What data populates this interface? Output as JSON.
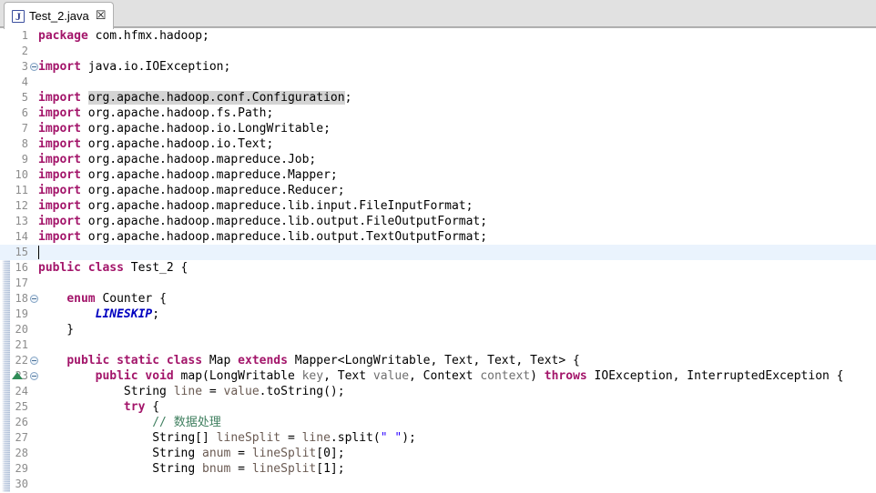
{
  "window": {
    "app": "eclipse-java-editor"
  },
  "tabbar": {
    "tabs": [
      {
        "label": "Test_2.java",
        "icon": "java-file-icon",
        "icon_glyph": "J",
        "close_glyph": "☒",
        "active": true
      }
    ]
  },
  "editor": {
    "current_line": 15,
    "total_visible_lines": 30,
    "colors": {
      "keyword": "#a3156a",
      "string": "#2a00ff",
      "comment": "#3f7f5f",
      "static_field": "#0000c0",
      "parameter": "#6f6f6f",
      "local_variable": "#6a5a52",
      "line_number": "#8c8c8c",
      "current_line_bg": "#eaf3fd",
      "occurrence_highlight_bg": "#d4d4d4",
      "fold_range_bar": "#aebfd8",
      "override_marker": "#2f8b57"
    },
    "lines": [
      {
        "n": 1,
        "fold": false,
        "tokens": [
          {
            "t": "package",
            "c": "kw"
          },
          {
            "t": " com.hfmx.hadoop;",
            "c": "pkg"
          }
        ]
      },
      {
        "n": 2,
        "fold": false,
        "tokens": []
      },
      {
        "n": 3,
        "fold": true,
        "tokens": [
          {
            "t": "import",
            "c": "kw"
          },
          {
            "t": " java.io.IOException;",
            "c": "pkg"
          }
        ]
      },
      {
        "n": 4,
        "fold": false,
        "tokens": []
      },
      {
        "n": 5,
        "fold": false,
        "tokens": [
          {
            "t": "import",
            "c": "kw"
          },
          {
            "t": " ",
            "c": "pkg"
          },
          {
            "t": "org.apache.hadoop.conf.Configuration",
            "c": "pkg hl"
          },
          {
            "t": ";",
            "c": "pkg"
          }
        ]
      },
      {
        "n": 6,
        "fold": false,
        "tokens": [
          {
            "t": "import",
            "c": "kw"
          },
          {
            "t": " org.apache.hadoop.fs.Path;",
            "c": "pkg"
          }
        ]
      },
      {
        "n": 7,
        "fold": false,
        "tokens": [
          {
            "t": "import",
            "c": "kw"
          },
          {
            "t": " org.apache.hadoop.io.LongWritable;",
            "c": "pkg"
          }
        ]
      },
      {
        "n": 8,
        "fold": false,
        "tokens": [
          {
            "t": "import",
            "c": "kw"
          },
          {
            "t": " org.apache.hadoop.io.Text;",
            "c": "pkg"
          }
        ]
      },
      {
        "n": 9,
        "fold": false,
        "tokens": [
          {
            "t": "import",
            "c": "kw"
          },
          {
            "t": " org.apache.hadoop.mapreduce.Job;",
            "c": "pkg"
          }
        ]
      },
      {
        "n": 10,
        "fold": false,
        "tokens": [
          {
            "t": "import",
            "c": "kw"
          },
          {
            "t": " org.apache.hadoop.mapreduce.Mapper;",
            "c": "pkg"
          }
        ]
      },
      {
        "n": 11,
        "fold": false,
        "tokens": [
          {
            "t": "import",
            "c": "kw"
          },
          {
            "t": " org.apache.hadoop.mapreduce.Reducer;",
            "c": "pkg"
          }
        ]
      },
      {
        "n": 12,
        "fold": false,
        "tokens": [
          {
            "t": "import",
            "c": "kw"
          },
          {
            "t": " org.apache.hadoop.mapreduce.lib.input.FileInputFormat;",
            "c": "pkg"
          }
        ]
      },
      {
        "n": 13,
        "fold": false,
        "tokens": [
          {
            "t": "import",
            "c": "kw"
          },
          {
            "t": " org.apache.hadoop.mapreduce.lib.output.FileOutputFormat;",
            "c": "pkg"
          }
        ]
      },
      {
        "n": 14,
        "fold": false,
        "tokens": [
          {
            "t": "import",
            "c": "kw"
          },
          {
            "t": " org.apache.hadoop.mapreduce.lib.output.TextOutputFormat;",
            "c": "pkg"
          }
        ]
      },
      {
        "n": 15,
        "fold": false,
        "current": true,
        "tokens": []
      },
      {
        "n": 16,
        "fold": false,
        "tokens": [
          {
            "t": "public class",
            "c": "kw"
          },
          {
            "t": " Test_2 {",
            "c": "plain"
          }
        ]
      },
      {
        "n": 17,
        "fold": false,
        "tokens": []
      },
      {
        "n": 18,
        "fold": true,
        "tokens": [
          {
            "t": "    ",
            "c": "plain"
          },
          {
            "t": "enum",
            "c": "kw"
          },
          {
            "t": " Counter {",
            "c": "plain"
          }
        ]
      },
      {
        "n": 19,
        "fold": false,
        "tokens": [
          {
            "t": "        ",
            "c": "plain"
          },
          {
            "t": "LINESKIP",
            "c": "field"
          },
          {
            "t": ";",
            "c": "plain"
          }
        ]
      },
      {
        "n": 20,
        "fold": false,
        "tokens": [
          {
            "t": "    }",
            "c": "plain"
          }
        ]
      },
      {
        "n": 21,
        "fold": false,
        "tokens": []
      },
      {
        "n": 22,
        "fold": true,
        "tokens": [
          {
            "t": "    ",
            "c": "plain"
          },
          {
            "t": "public static class",
            "c": "kw"
          },
          {
            "t": " Map ",
            "c": "plain"
          },
          {
            "t": "extends",
            "c": "kw"
          },
          {
            "t": " Mapper<LongWritable, Text, Text, Text> {",
            "c": "plain"
          }
        ]
      },
      {
        "n": 23,
        "fold": true,
        "override": true,
        "tokens": [
          {
            "t": "        ",
            "c": "plain"
          },
          {
            "t": "public void",
            "c": "kw"
          },
          {
            "t": " map(LongWritable ",
            "c": "plain"
          },
          {
            "t": "key",
            "c": "param"
          },
          {
            "t": ", Text ",
            "c": "plain"
          },
          {
            "t": "value",
            "c": "param"
          },
          {
            "t": ", Context ",
            "c": "plain"
          },
          {
            "t": "context",
            "c": "param"
          },
          {
            "t": ") ",
            "c": "plain"
          },
          {
            "t": "throws",
            "c": "kw"
          },
          {
            "t": " IOException, InterruptedException {",
            "c": "plain"
          }
        ]
      },
      {
        "n": 24,
        "fold": false,
        "tokens": [
          {
            "t": "            String ",
            "c": "plain"
          },
          {
            "t": "line",
            "c": "localvar"
          },
          {
            "t": " = ",
            "c": "plain"
          },
          {
            "t": "value",
            "c": "localvar"
          },
          {
            "t": ".toString();",
            "c": "plain"
          }
        ]
      },
      {
        "n": 25,
        "fold": false,
        "tokens": [
          {
            "t": "            ",
            "c": "plain"
          },
          {
            "t": "try",
            "c": "kw"
          },
          {
            "t": " {",
            "c": "plain"
          }
        ]
      },
      {
        "n": 26,
        "fold": false,
        "tokens": [
          {
            "t": "                ",
            "c": "plain"
          },
          {
            "t": "// 数据处理",
            "c": "cmt"
          }
        ]
      },
      {
        "n": 27,
        "fold": false,
        "tokens": [
          {
            "t": "                String[] ",
            "c": "plain"
          },
          {
            "t": "lineSplit",
            "c": "localvar"
          },
          {
            "t": " = ",
            "c": "plain"
          },
          {
            "t": "line",
            "c": "localvar"
          },
          {
            "t": ".split(",
            "c": "plain"
          },
          {
            "t": "\" \"",
            "c": "str"
          },
          {
            "t": ");",
            "c": "plain"
          }
        ]
      },
      {
        "n": 28,
        "fold": false,
        "tokens": [
          {
            "t": "                String ",
            "c": "plain"
          },
          {
            "t": "anum",
            "c": "localvar"
          },
          {
            "t": " = ",
            "c": "plain"
          },
          {
            "t": "lineSplit",
            "c": "localvar"
          },
          {
            "t": "[0];",
            "c": "plain"
          }
        ]
      },
      {
        "n": 29,
        "fold": false,
        "tokens": [
          {
            "t": "                String ",
            "c": "plain"
          },
          {
            "t": "bnum",
            "c": "localvar"
          },
          {
            "t": " = ",
            "c": "plain"
          },
          {
            "t": "lineSplit",
            "c": "localvar"
          },
          {
            "t": "[1];",
            "c": "plain"
          }
        ]
      },
      {
        "n": 30,
        "fold": false,
        "tokens": []
      }
    ]
  }
}
